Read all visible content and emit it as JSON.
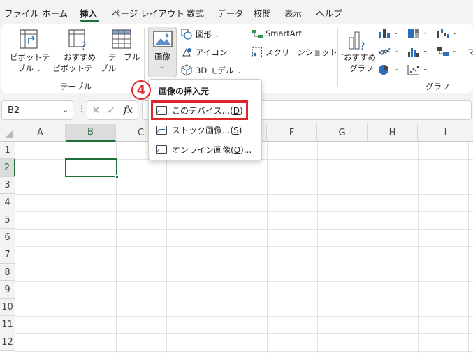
{
  "tabs": [
    {
      "label": "ファイル",
      "active": false
    },
    {
      "label": "ホーム",
      "active": false
    },
    {
      "label": "挿入",
      "active": true
    },
    {
      "label": "ページ レイアウト",
      "active": false
    },
    {
      "label": "数式",
      "active": false
    },
    {
      "label": "データ",
      "active": false
    },
    {
      "label": "校閲",
      "active": false
    },
    {
      "label": "表示",
      "active": false
    },
    {
      "label": "ヘルプ",
      "active": false
    }
  ],
  "ribbon": {
    "pivot_table": {
      "line1": "ピボットテー",
      "line2": "ブル"
    },
    "recommended_pivot": {
      "line1": "おすすめ",
      "line2": "ピボットテーブル"
    },
    "table": "テーブル",
    "group_table": "テーブル",
    "image": "画像",
    "shapes": "図形",
    "icons": "アイコン",
    "model3d": "3D モデル",
    "smartart": "SmartArt",
    "screenshot": "スクリーンショット",
    "recommended_charts": {
      "line1": "おすすめ",
      "line2": "グラフ"
    },
    "group_chart": "グラフ"
  },
  "formula_bar": {
    "name_box": "B2",
    "fx": "fx",
    "value": ""
  },
  "grid": {
    "columns": [
      "A",
      "B",
      "C",
      "D",
      "E",
      "F",
      "G",
      "H",
      "I"
    ],
    "rows": [
      "1",
      "2",
      "3",
      "4",
      "5",
      "6",
      "7",
      "8",
      "9",
      "10",
      "11",
      "12"
    ],
    "active_cell": "B2"
  },
  "dropdown": {
    "header": "画像の挿入元",
    "items": [
      {
        "label": "このデバイス...",
        "key": "D",
        "highlighted": true
      },
      {
        "label": "ストック画像...",
        "key": "S",
        "highlighted": false
      },
      {
        "label": "オンライン画像",
        "key": "O",
        "suffix": "..."
      }
    ]
  },
  "annotation": {
    "step_number": "4",
    "color": "#e0262b"
  },
  "colors": {
    "accent": "#1e6e3a",
    "highlight_box": "#e0262b"
  }
}
